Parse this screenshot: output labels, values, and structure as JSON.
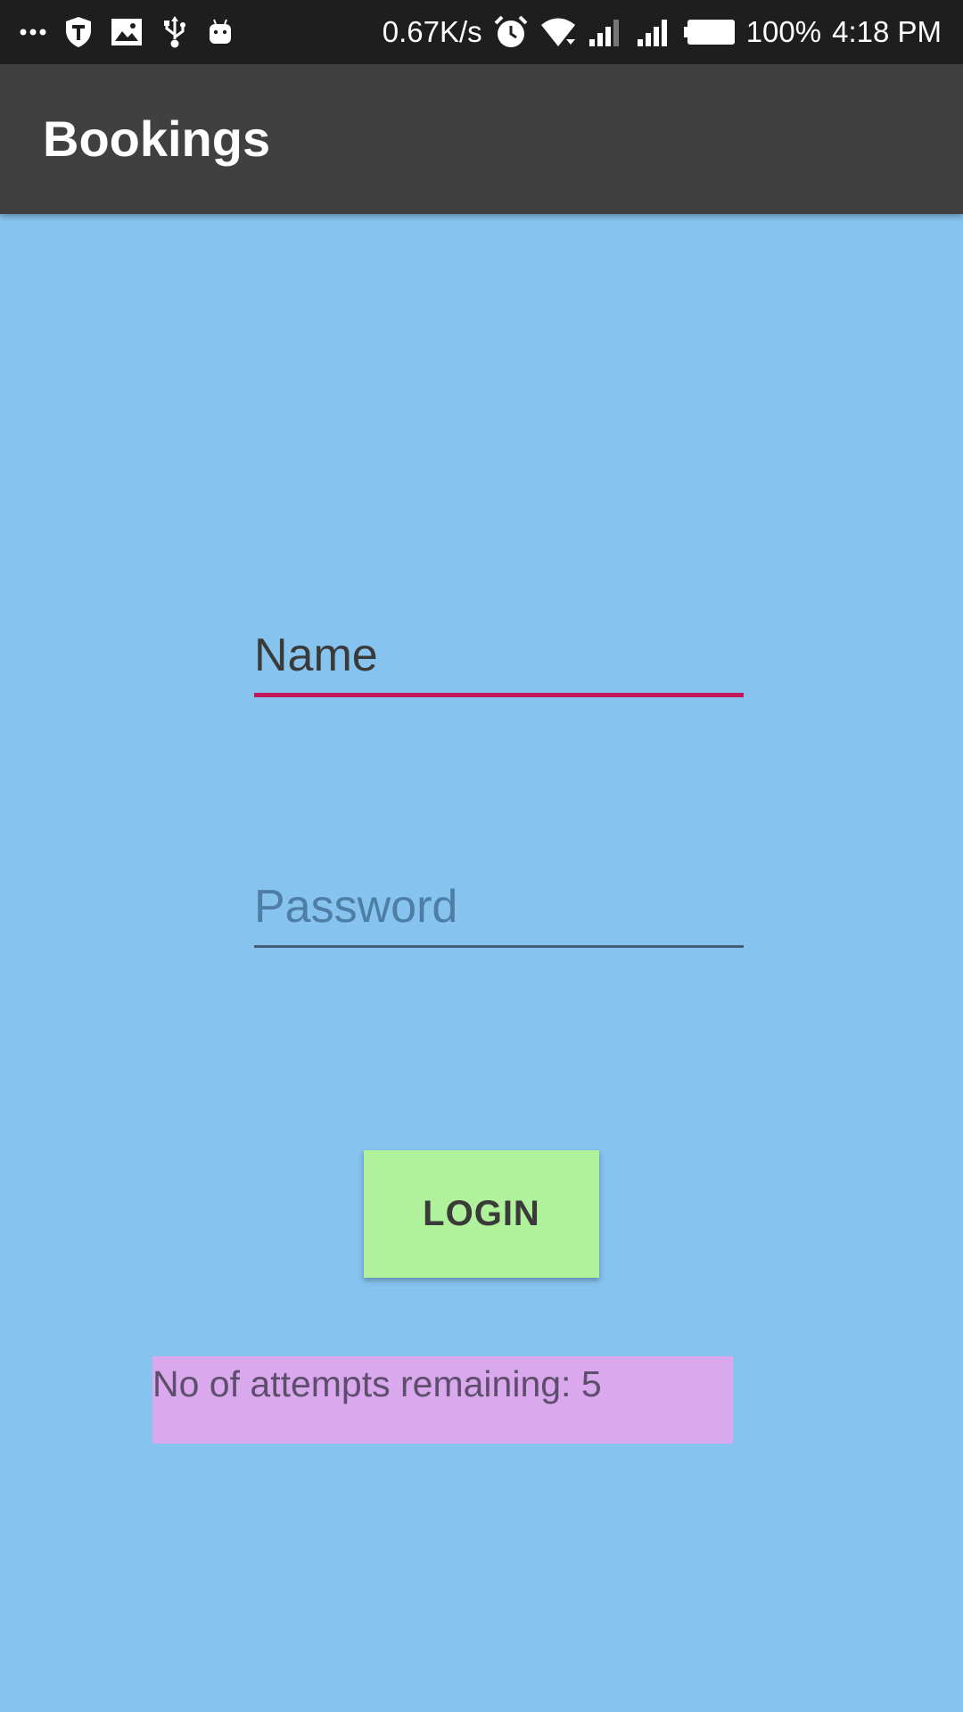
{
  "status_bar": {
    "left_icons": [
      "more-icon",
      "shield-icon",
      "image-icon",
      "usb-icon",
      "android-icon"
    ],
    "net_speed": "0.67K/s",
    "right_icons": [
      "alarm-icon",
      "wifi-icon",
      "signal-icon",
      "signal-icon",
      "battery-icon"
    ],
    "battery_percent": "100%",
    "time": "4:18 PM"
  },
  "app_bar": {
    "title": "Bookings"
  },
  "form": {
    "name_placeholder": "Name",
    "password_placeholder": "Password",
    "login_label": "LOGIN"
  },
  "attempts": {
    "text": "No of attempts remaining: 5"
  },
  "colors": {
    "background": "#87C3EF",
    "app_bar": "#404040",
    "status_bar": "#1E1E1E",
    "accent_underline": "#C2185B",
    "login_button": "#B0F29B",
    "attempts_box": "#DAA8EC"
  }
}
